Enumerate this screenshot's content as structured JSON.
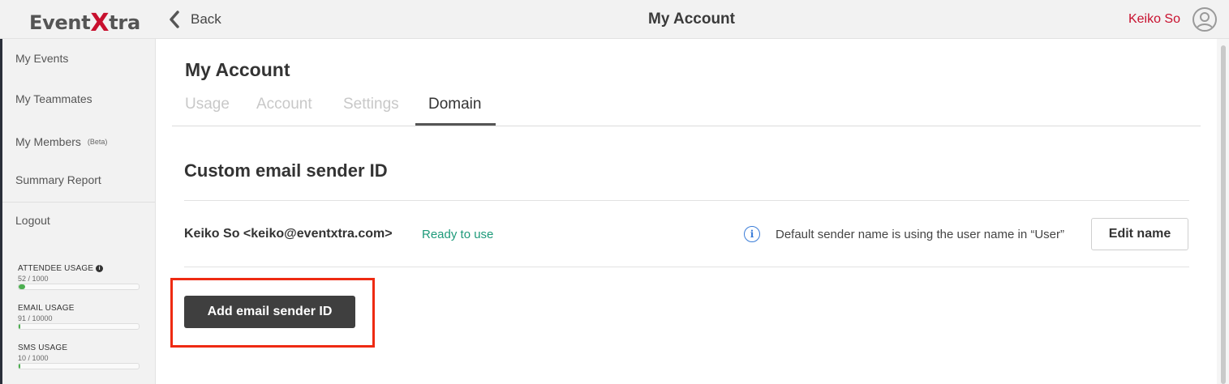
{
  "app": {
    "logo_pre": "Event",
    "logo_x": "X",
    "logo_post": "tra",
    "accent_color": "#c8102e"
  },
  "topbar": {
    "back_label": "Back",
    "title": "My Account",
    "user_name": "Keiko So"
  },
  "sidebar": {
    "items": [
      {
        "label": "My Events"
      },
      {
        "label": "My Teammates"
      },
      {
        "label": "My Members",
        "badge": "(Beta)"
      },
      {
        "label": "Summary Report"
      },
      {
        "label": "Logout"
      }
    ],
    "usage": [
      {
        "label": "ATTENDEE USAGE",
        "count": "52 / 1000",
        "fraction": 0.052
      },
      {
        "label": "EMAIL USAGE",
        "count": "91 / 10000",
        "fraction": 0.0091
      },
      {
        "label": "SMS USAGE",
        "count": "10 / 1000",
        "fraction": 0.01
      }
    ]
  },
  "main": {
    "title": "My Account",
    "tabs": [
      {
        "label": "Usage"
      },
      {
        "label": "Account"
      },
      {
        "label": "Settings"
      },
      {
        "label": "Domain",
        "active": true
      }
    ],
    "section_title": "Custom email sender ID",
    "sender": {
      "display": "Keiko So <keiko@eventxtra.com>",
      "status": "Ready to use",
      "status_color": "#1e9a7a",
      "note": "Default sender name is using the user name in “User”",
      "edit_label": "Edit name"
    },
    "add_label": "Add email sender ID",
    "highlight_color": "#ee2a12"
  }
}
